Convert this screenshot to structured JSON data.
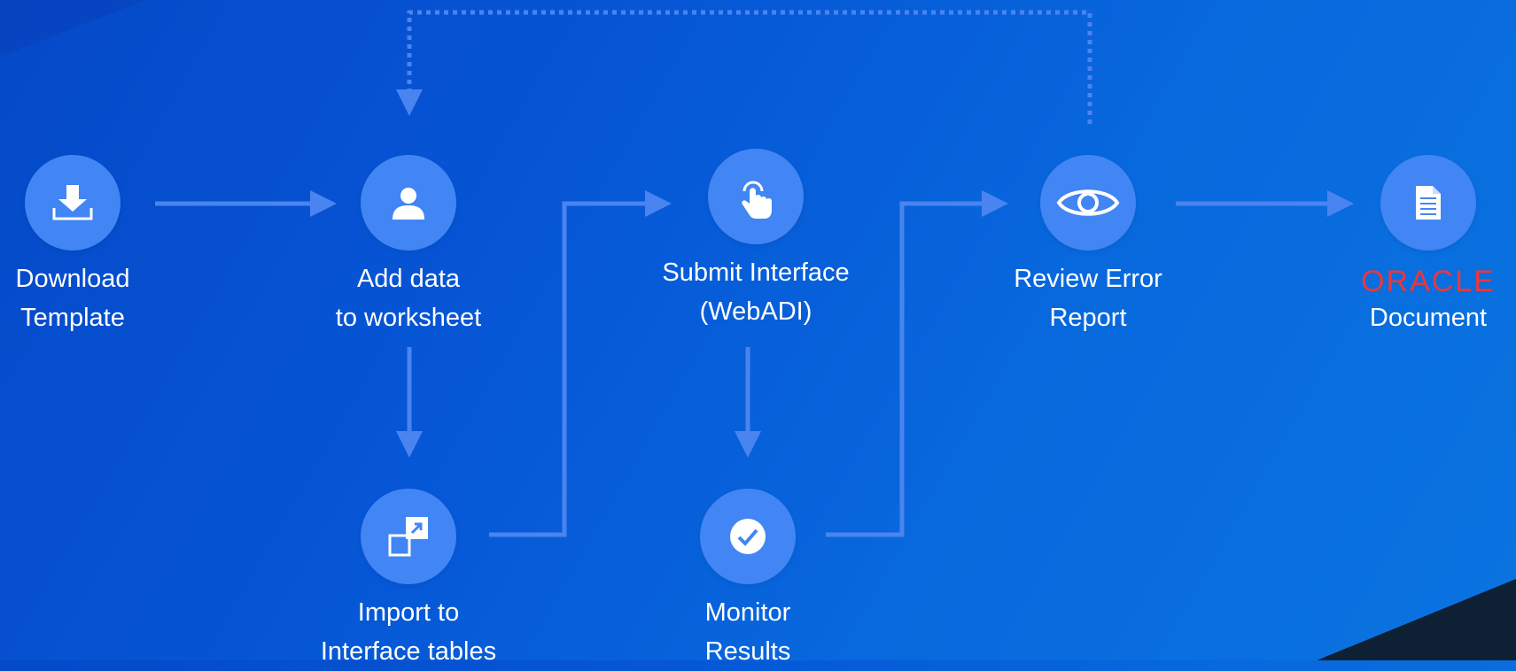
{
  "diagram": {
    "nodes": [
      {
        "id": "download",
        "icon": "download-icon",
        "lines": [
          "Download",
          "Template"
        ]
      },
      {
        "id": "add-data",
        "icon": "user-icon",
        "lines": [
          "Add data",
          "to worksheet"
        ]
      },
      {
        "id": "submit",
        "icon": "tap-icon",
        "lines": [
          "Submit Interface",
          "(WebADI)"
        ]
      },
      {
        "id": "review",
        "icon": "eye-icon",
        "lines": [
          "Review Error",
          "Report"
        ]
      },
      {
        "id": "document",
        "icon": "document-icon",
        "brand": "ORACLE",
        "lines": [
          "Document"
        ]
      },
      {
        "id": "import",
        "icon": "import-icon",
        "lines": [
          "Import to",
          "Interface tables"
        ]
      },
      {
        "id": "monitor",
        "icon": "check-icon",
        "lines": [
          "Monitor",
          "Results"
        ]
      }
    ],
    "colors": {
      "node": "#4285f4",
      "connector": "#4a84f0",
      "brand": "#e8383d",
      "text": "#ffffff"
    }
  }
}
